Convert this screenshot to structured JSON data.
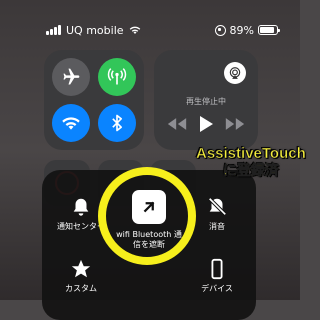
{
  "status_bar": {
    "carrier": "UQ mobile",
    "battery": "89%",
    "battery_level": 0.89
  },
  "connectivity": {
    "buttons": [
      {
        "name": "airplane-mode",
        "icon": "airplane-icon",
        "state": "off",
        "color": "#5b5b5e"
      },
      {
        "name": "cellular-data",
        "icon": "antenna-icon",
        "state": "on",
        "color": "#32c659"
      },
      {
        "name": "wifi",
        "icon": "wifi-icon",
        "state": "on",
        "color": "#0a84ff"
      },
      {
        "name": "bluetooth",
        "icon": "bluetooth-icon",
        "state": "on",
        "color": "#0a84ff"
      }
    ]
  },
  "music": {
    "status": "再生停止中",
    "icons": [
      "airplay-icon",
      "rewind-icon",
      "play-icon",
      "fast-forward-icon"
    ]
  },
  "annotation": {
    "line1": "AssistiveTouch",
    "line2": "に登録済",
    "color": "#f6ef38"
  },
  "assistive_menu": {
    "items": {
      "notification_center": "通知センター",
      "lock_label": "wifi Bluetooth 通信を遮断",
      "mute": "消音",
      "custom": "カスタム",
      "device": "デバイス"
    },
    "highlight_color": "#f6ef1c"
  }
}
